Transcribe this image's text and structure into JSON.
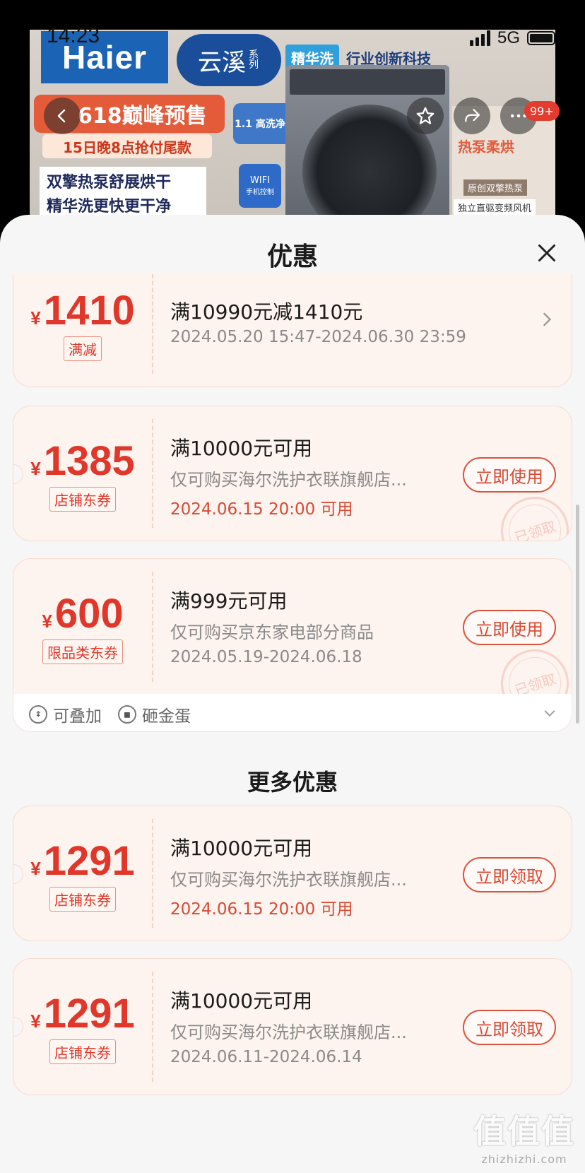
{
  "status_bar": {
    "time": "14:23",
    "network": "5G"
  },
  "banner": {
    "brand": "Haier",
    "series": "云溪",
    "series_suffix": "系列",
    "tag_1": "精华洗",
    "tag_2": "行业创新科技",
    "promo": "618巅峰预售",
    "promo_sub": "15日晚8点抢付尾款",
    "line_1": "双擎热泵舒展烘干",
    "line_2": "精华洗更快更干净",
    "wash_badge": "1.1 高洗净比",
    "wifi": "WIFI",
    "wifi_sub": "手机控制",
    "right_hot": "热泵柔烘",
    "right_c1": "原创双擎热泵",
    "right_c2": "独立直驱变频风机",
    "cart_badge": "99+"
  },
  "sheet": {
    "title": "优惠",
    "more_title": "更多优惠",
    "currency": "¥",
    "coupons": [
      {
        "amount": "1410",
        "type": "满减",
        "main": "满10990元减1410元",
        "date": "2024.05.20 15:47-2024.06.30 23:59"
      },
      {
        "amount": "1385",
        "type": "店铺东券",
        "main": "满10000元可用",
        "sub": "仅可购买海尔洗护衣联旗舰店...",
        "date": "2024.06.15 20:00 可用",
        "button": "立即使用",
        "stamp": "已领取"
      },
      {
        "amount": "600",
        "type": "限品类东券",
        "main": "满999元可用",
        "sub": "仅可购买京东家电部分商品",
        "date": "2024.05.19-2024.06.18",
        "button": "立即使用",
        "stamp": "已领取"
      },
      {
        "amount": "1291",
        "type": "店铺东券",
        "main": "满10000元可用",
        "sub": "仅可购买海尔洗护衣联旗舰店...",
        "date": "2024.06.15 20:00 可用",
        "button": "立即领取"
      },
      {
        "amount": "1291",
        "type": "店铺东券",
        "main": "满10000元可用",
        "sub": "仅可购买海尔洗护衣联旗舰店...",
        "date": "2024.06.11-2024.06.14",
        "button": "立即领取"
      }
    ],
    "tags": [
      "可叠加",
      "砸金蛋"
    ]
  },
  "watermark": {
    "big": "值值值",
    "small": "zhizhizhi.com"
  }
}
